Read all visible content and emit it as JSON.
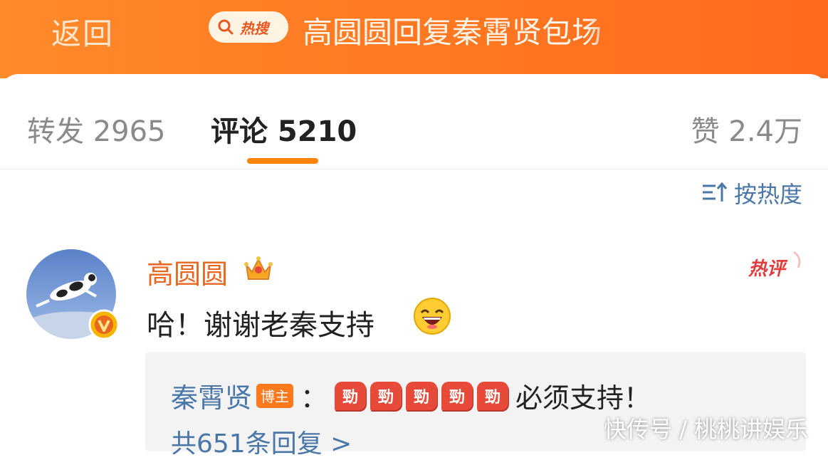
{
  "header": {
    "back_label": "返回",
    "hot_search_label": "热搜",
    "title": "高圆圆回复秦霄贤包场"
  },
  "tabs": {
    "repost": "转发 2965",
    "comment": "评论 5210",
    "like": "赞 2.4万"
  },
  "sort": {
    "label": "按热度"
  },
  "comment": {
    "username": "高圆圆",
    "text": "哈！谢谢老秦支持",
    "hot_tag": "热评",
    "reply": {
      "user": "秦霄贤",
      "badge": "博主",
      "colon": "：",
      "emoji_text": "勁",
      "emoji_count": 5,
      "text": "必须支持！",
      "count_label": "共651条回复 >"
    }
  },
  "watermark": "快传号 / 桃桃讲娱乐",
  "colors": {
    "header_orange": "#ff7a22",
    "accent_underline": "#ff8200",
    "link_blue": "#4a76a8",
    "username_orange": "#e8661f",
    "badge_orange": "#ff7a1f"
  }
}
